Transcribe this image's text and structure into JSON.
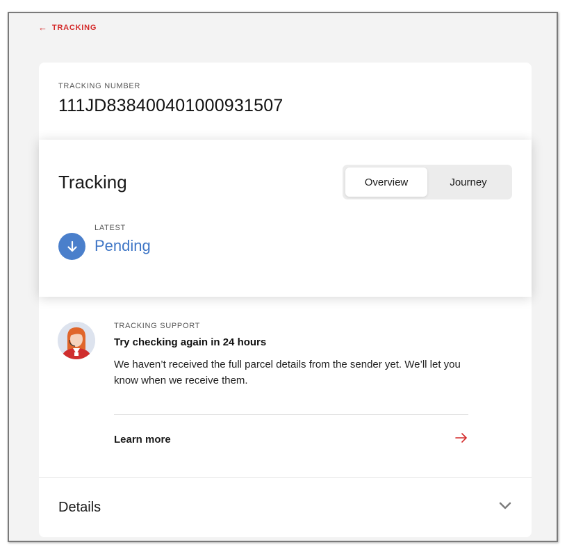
{
  "nav": {
    "back_label": "TRACKING"
  },
  "tracking_number": {
    "label": "TRACKING NUMBER",
    "value": "111JD838400401000931507"
  },
  "tracking": {
    "title": "Tracking",
    "tabs": [
      {
        "label": "Overview",
        "active": true
      },
      {
        "label": "Journey",
        "active": false
      }
    ],
    "latest_label": "LATEST",
    "latest_status": "Pending"
  },
  "support": {
    "label": "TRACKING SUPPORT",
    "title": "Try checking again in 24 hours",
    "body": "We haven’t received the full parcel details from the sender yet. We’ll let you know when we receive them.",
    "learn_more": "Learn more"
  },
  "details": {
    "label": "Details"
  },
  "colors": {
    "accent_red": "#d42a2a",
    "status_blue": "#3f76c6",
    "icon_blue": "#4a7fcb"
  }
}
